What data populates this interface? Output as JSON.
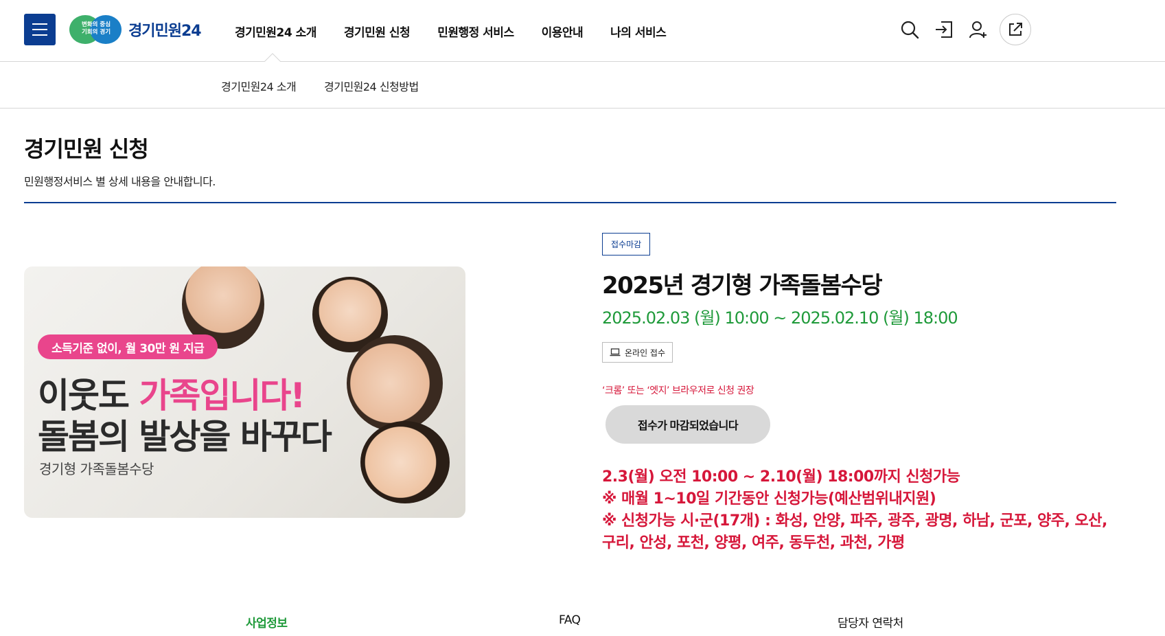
{
  "header": {
    "logo_badge_line1": "변화의 중심",
    "logo_badge_line2": "기회의 경기",
    "logo_text": "경기민원24",
    "nav": [
      "경기민원24 소개",
      "경기민원 신청",
      "민원행정 서비스",
      "이용안내",
      "나의 서비스"
    ],
    "icons": [
      "search-icon",
      "login-icon",
      "user-add-icon",
      "external-link-icon"
    ],
    "brand_color": "#0b3d91"
  },
  "subnav": {
    "items": [
      "경기민원24 소개",
      "경기민원24 신청방법"
    ]
  },
  "page": {
    "title": "경기민원 신청",
    "description": "민원행정서비스 별 상세 내용을 안내합니다."
  },
  "banner": {
    "pill": "소득기준 없이, 월 30만 원 지급",
    "line1_prefix": "이웃도 ",
    "line1_highlight": "가족입니다!",
    "line2": "돌봄의 발상을 바꾸다",
    "sub": "경기형 가족돌봄수당",
    "accent_color": "#e9458c"
  },
  "detail": {
    "status": "접수마감",
    "title": "2025년 경기형 가족돌봄수당",
    "period": "2025.02.03 (월) 10:00 ~ 2025.02.10 (월) 18:00",
    "method": "온라인 접수",
    "browser_note": "‘크롬’ 또는 ‘엣지’ 브라우저로 신청 권장",
    "closed_button": "접수가 마감되었습니다",
    "notice_lines": [
      "2.3(월) 오전 10:00 ~ 2.10(월) 18:00까지 신청가능",
      "※ 매월 1~10일 기간동안 신청가능(예산범위내지원)",
      "※ 신청가능 시·군(17개) : 화성, 안양, 파주, 광주, 광명, 하남, 군포, 양주, 오산, 구리, 안성, 포천, 양평, 여주, 동두천, 과천, 가평"
    ],
    "period_color": "#1f9a3a",
    "alert_color": "#d6173a"
  },
  "tabs": {
    "items": [
      "사업정보",
      "FAQ",
      "담당자 연락처"
    ],
    "active": "사업정보"
  }
}
